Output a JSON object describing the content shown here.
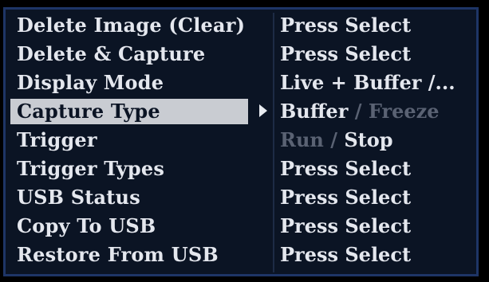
{
  "menu": {
    "rows": [
      {
        "label": "Delete Image (Clear)",
        "value": "Press Select"
      },
      {
        "label": "Delete & Capture",
        "value": "Press Select"
      },
      {
        "label": "Display Mode",
        "value": "Live + Buffer /..."
      },
      {
        "label": "Capture Type",
        "value_active": "Buffer",
        "separator": " / ",
        "value_inactive": "Freeze"
      },
      {
        "label": "Trigger",
        "value_inactive": "Run",
        "separator": " / ",
        "value_active": "Stop"
      },
      {
        "label": "Trigger Types",
        "value": "Press Select"
      },
      {
        "label": "USB Status",
        "value": "Press Select"
      },
      {
        "label": "Copy To USB",
        "value": "Press Select"
      },
      {
        "label": "Restore From USB",
        "value": "Press Select"
      }
    ],
    "selected_index": 3
  },
  "colors": {
    "menu_background": "#0b1424",
    "menu_border": "#1e3566",
    "text": "#e4e7ee",
    "dim_text": "#5a6273",
    "selection_background": "#c9ccd2"
  }
}
